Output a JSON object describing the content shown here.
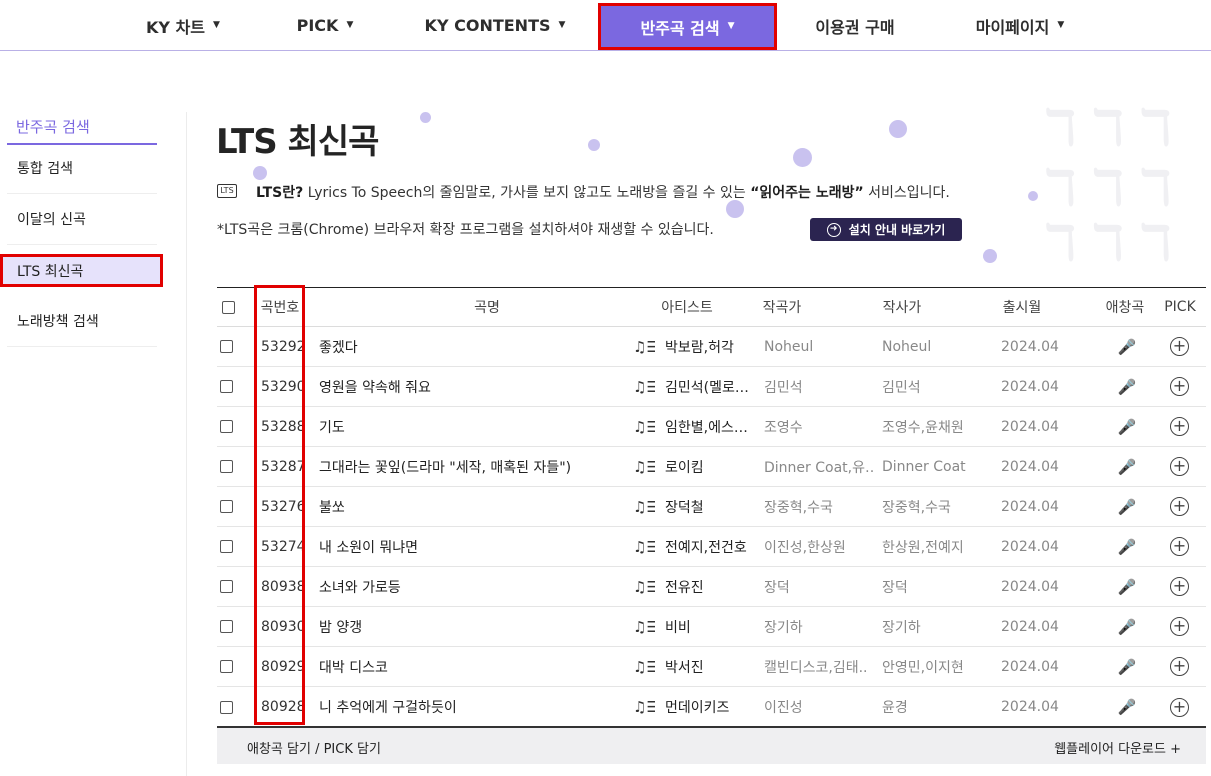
{
  "nav": {
    "items": [
      {
        "label": "KY 차트"
      },
      {
        "label": "PICK"
      },
      {
        "label": "KY CONTENTS"
      },
      {
        "label": "반주곡 검색"
      },
      {
        "label": "이용권 구매"
      },
      {
        "label": "마이페이지"
      }
    ]
  },
  "sidebar": {
    "title": "반주곡 검색",
    "items": [
      {
        "label": "통합 검색"
      },
      {
        "label": "이달의 신곡"
      },
      {
        "label": "LTS 최신곡"
      },
      {
        "label": "노래방책 검색"
      }
    ]
  },
  "header": {
    "title": "LTS 최신곡",
    "badge": "LTS",
    "desc_bold": "LTS란?",
    "desc_text": " Lyrics To Speech의 줄임말로, 가사를 보지 않고도 노래방을 즐길 수 있는 ",
    "desc_quote": "“읽어주는 노래방”",
    "desc_tail": " 서비스입니다.",
    "note": "*LTS곡은 크롬(Chrome) 브라우저 확장 프로그램을 설치하셔야 재생할 수 있습니다.",
    "guide_button": "설치 안내 바로가기"
  },
  "table": {
    "columns": [
      "곡번호",
      "곡명",
      "아티스트",
      "작곡가",
      "작사가",
      "출시월",
      "애창곡",
      "PICK"
    ],
    "rows": [
      {
        "num": "53292",
        "title": "좋겠다",
        "artist": "박보람,허각",
        "composer": "Noheul",
        "lyricist": "Noheul",
        "date": "2024.04"
      },
      {
        "num": "53290",
        "title": "영원을 약속해 줘요",
        "artist": "김민석(멜로…",
        "composer": "김민석",
        "lyricist": "김민석",
        "date": "2024.04"
      },
      {
        "num": "53288",
        "title": "기도",
        "artist": "임한별,에스…",
        "composer": "조영수",
        "lyricist": "조영수,윤채원",
        "date": "2024.04"
      },
      {
        "num": "53287",
        "title": "그대라는 꽃잎(드라마 \"세작, 매혹된 자들\")",
        "artist": "로이킴",
        "composer": "Dinner Coat,유…",
        "lyricist": "Dinner Coat",
        "date": "2024.04"
      },
      {
        "num": "53276",
        "title": "불쏘",
        "artist": "장덕철",
        "composer": "장중혁,수국",
        "lyricist": "장중혁,수국",
        "date": "2024.04"
      },
      {
        "num": "53274",
        "title": "내 소원이 뭐냐면",
        "artist": "전예지,전건호",
        "composer": "이진성,한상원",
        "lyricist": "한상원,전예지",
        "date": "2024.04"
      },
      {
        "num": "80938",
        "title": "소녀와 가로등",
        "artist": "전유진",
        "composer": "장덕",
        "lyricist": "장덕",
        "date": "2024.04"
      },
      {
        "num": "80930",
        "title": "밤 양갱",
        "artist": "비비",
        "composer": "장기하",
        "lyricist": "장기하",
        "date": "2024.04"
      },
      {
        "num": "80929",
        "title": "대박 디스코",
        "artist": "박서진",
        "composer": "캘빈디스코,김태..",
        "lyricist": "안영민,이지현",
        "date": "2024.04"
      },
      {
        "num": "80928",
        "title": "니 추억에게 구걸하듯이",
        "artist": "먼데이키즈",
        "composer": "이진성",
        "lyricist": "윤경",
        "date": "2024.04"
      }
    ]
  },
  "footer": {
    "left": "애창곡 담기 / PICK 담기",
    "right": "웹플레이어 다운로드 +"
  },
  "colors": {
    "accent": "#7b68e0",
    "highlight": "#e10000",
    "button": "#2b2450"
  }
}
